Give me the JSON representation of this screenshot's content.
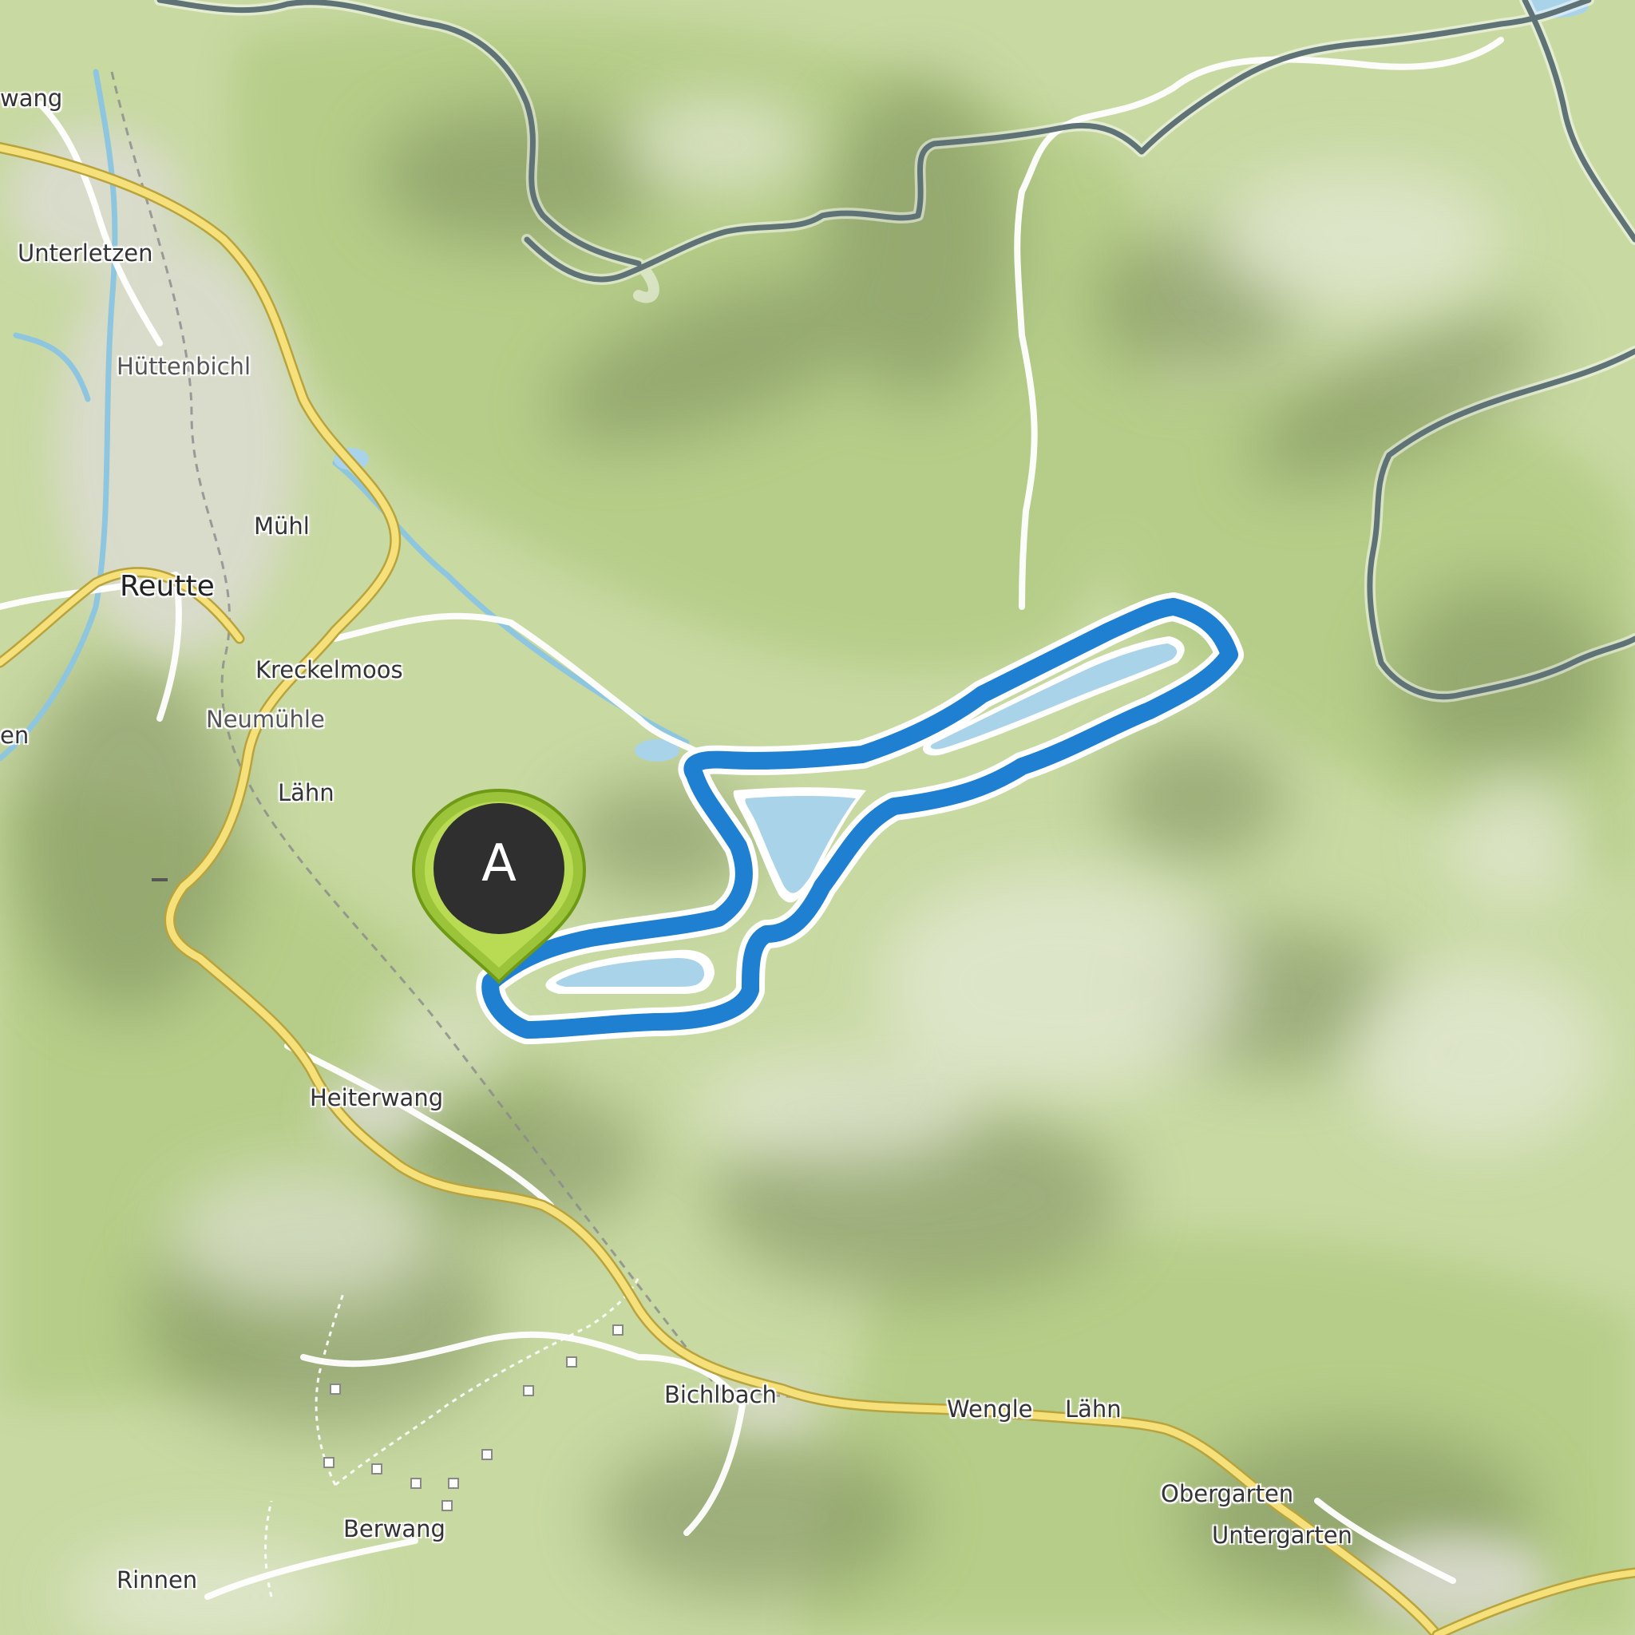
{
  "map": {
    "route_color": "#1f7fd1",
    "lake_color": "#a9d3e8",
    "border_color": "#5f7275",
    "road_color": "#f5e07a",
    "marker_color": "#9cc43a",
    "marker_label": "A",
    "places": {
      "berwang_top": "wang",
      "unterletzen": "Unterletzen",
      "huettenbichl": "Hüttenbichl",
      "muehl": "Mühl",
      "reutte": "Reutte",
      "kreckelmoos": "Kreckelmoos",
      "neumuehle": "Neumühle",
      "laehn_west": "Lähn",
      "edge_left": "en",
      "heiterwang": "Heiterwang",
      "bichlbach": "Bichlbach",
      "wengle": "Wengle",
      "laehn_east": "Lähn",
      "obergarten": "Obergarten",
      "untergarten": "Untergarten",
      "berwang": "Berwang",
      "rinnen": "Rinnen"
    }
  }
}
